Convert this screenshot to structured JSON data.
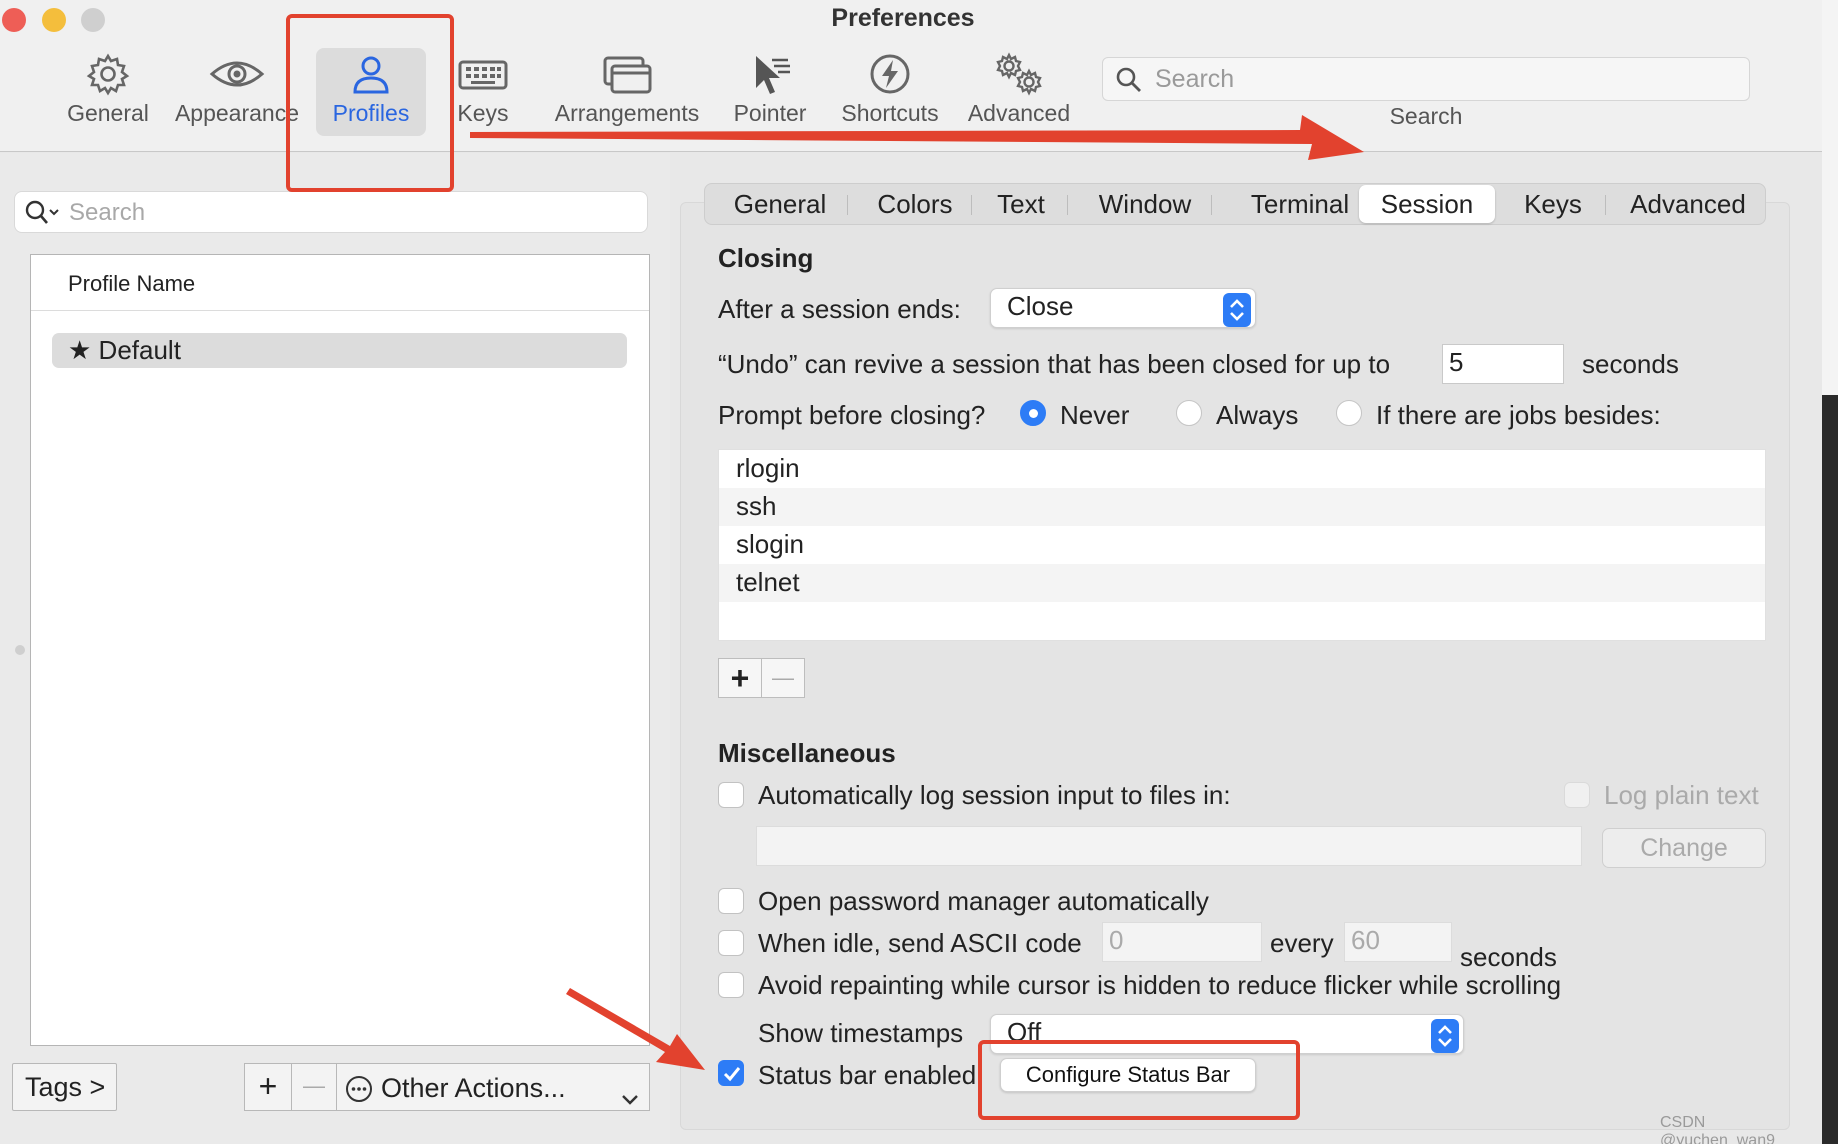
{
  "window": {
    "title": "Preferences"
  },
  "toolbar": {
    "items": [
      {
        "label": "General",
        "icon": "gear-icon"
      },
      {
        "label": "Appearance",
        "icon": "eye-icon"
      },
      {
        "label": "Profiles",
        "icon": "person-icon",
        "selected": true
      },
      {
        "label": "Keys",
        "icon": "keyboard-icon"
      },
      {
        "label": "Arrangements",
        "icon": "windows-icon"
      },
      {
        "label": "Pointer",
        "icon": "pointer-icon"
      },
      {
        "label": "Shortcuts",
        "icon": "bolt-icon"
      },
      {
        "label": "Advanced",
        "icon": "gears-icon"
      }
    ],
    "search_placeholder": "Search",
    "search_label": "Search"
  },
  "sidebar": {
    "search_placeholder": "Search",
    "column_header": "Profile Name",
    "profiles": [
      {
        "name": "Default",
        "default": true
      }
    ],
    "tags_button": "Tags >",
    "add_button": "+",
    "remove_button": "—",
    "other_actions": "Other Actions..."
  },
  "tabs": [
    {
      "label": "General"
    },
    {
      "label": "Colors"
    },
    {
      "label": "Text"
    },
    {
      "label": "Window"
    },
    {
      "label": "Terminal"
    },
    {
      "label": "Session",
      "active": true
    },
    {
      "label": "Keys"
    },
    {
      "label": "Advanced"
    }
  ],
  "session": {
    "closing": {
      "heading": "Closing",
      "after_label": "After a session ends:",
      "after_value": "Close",
      "undo_prefix": "“Undo” can revive a session that has been closed for up to",
      "undo_value": "5",
      "undo_suffix": "seconds",
      "prompt_label": "Prompt before closing?",
      "prompt_options": [
        "Never",
        "Always",
        "If there are jobs besides:"
      ],
      "prompt_selected": "Never",
      "jobs": [
        "rlogin",
        "ssh",
        "slogin",
        "telnet"
      ],
      "add": "+",
      "remove": "—"
    },
    "misc": {
      "heading": "Miscellaneous",
      "autolog_label": "Automatically log session input to files in:",
      "log_plain_label": "Log plain text",
      "log_path": "",
      "change_button": "Change",
      "password_manager_label": "Open password manager automatically",
      "idle_label": "When idle, send ASCII code",
      "idle_code": "0",
      "idle_every": "every",
      "idle_interval": "60",
      "idle_seconds": "seconds",
      "avoid_repaint_label": "Avoid repainting while cursor is hidden to reduce flicker while scrolling",
      "timestamps_label": "Show timestamps",
      "timestamps_value": "Off",
      "status_bar_label": "Status bar enabled",
      "status_bar_checked": true,
      "configure_status_bar": "Configure Status Bar"
    }
  },
  "watermark": "CSDN @yuchen_wan9",
  "colors": {
    "accent": "#2d7cf6",
    "annotation": "#e2422e",
    "selected_label": "#2a66e0"
  }
}
